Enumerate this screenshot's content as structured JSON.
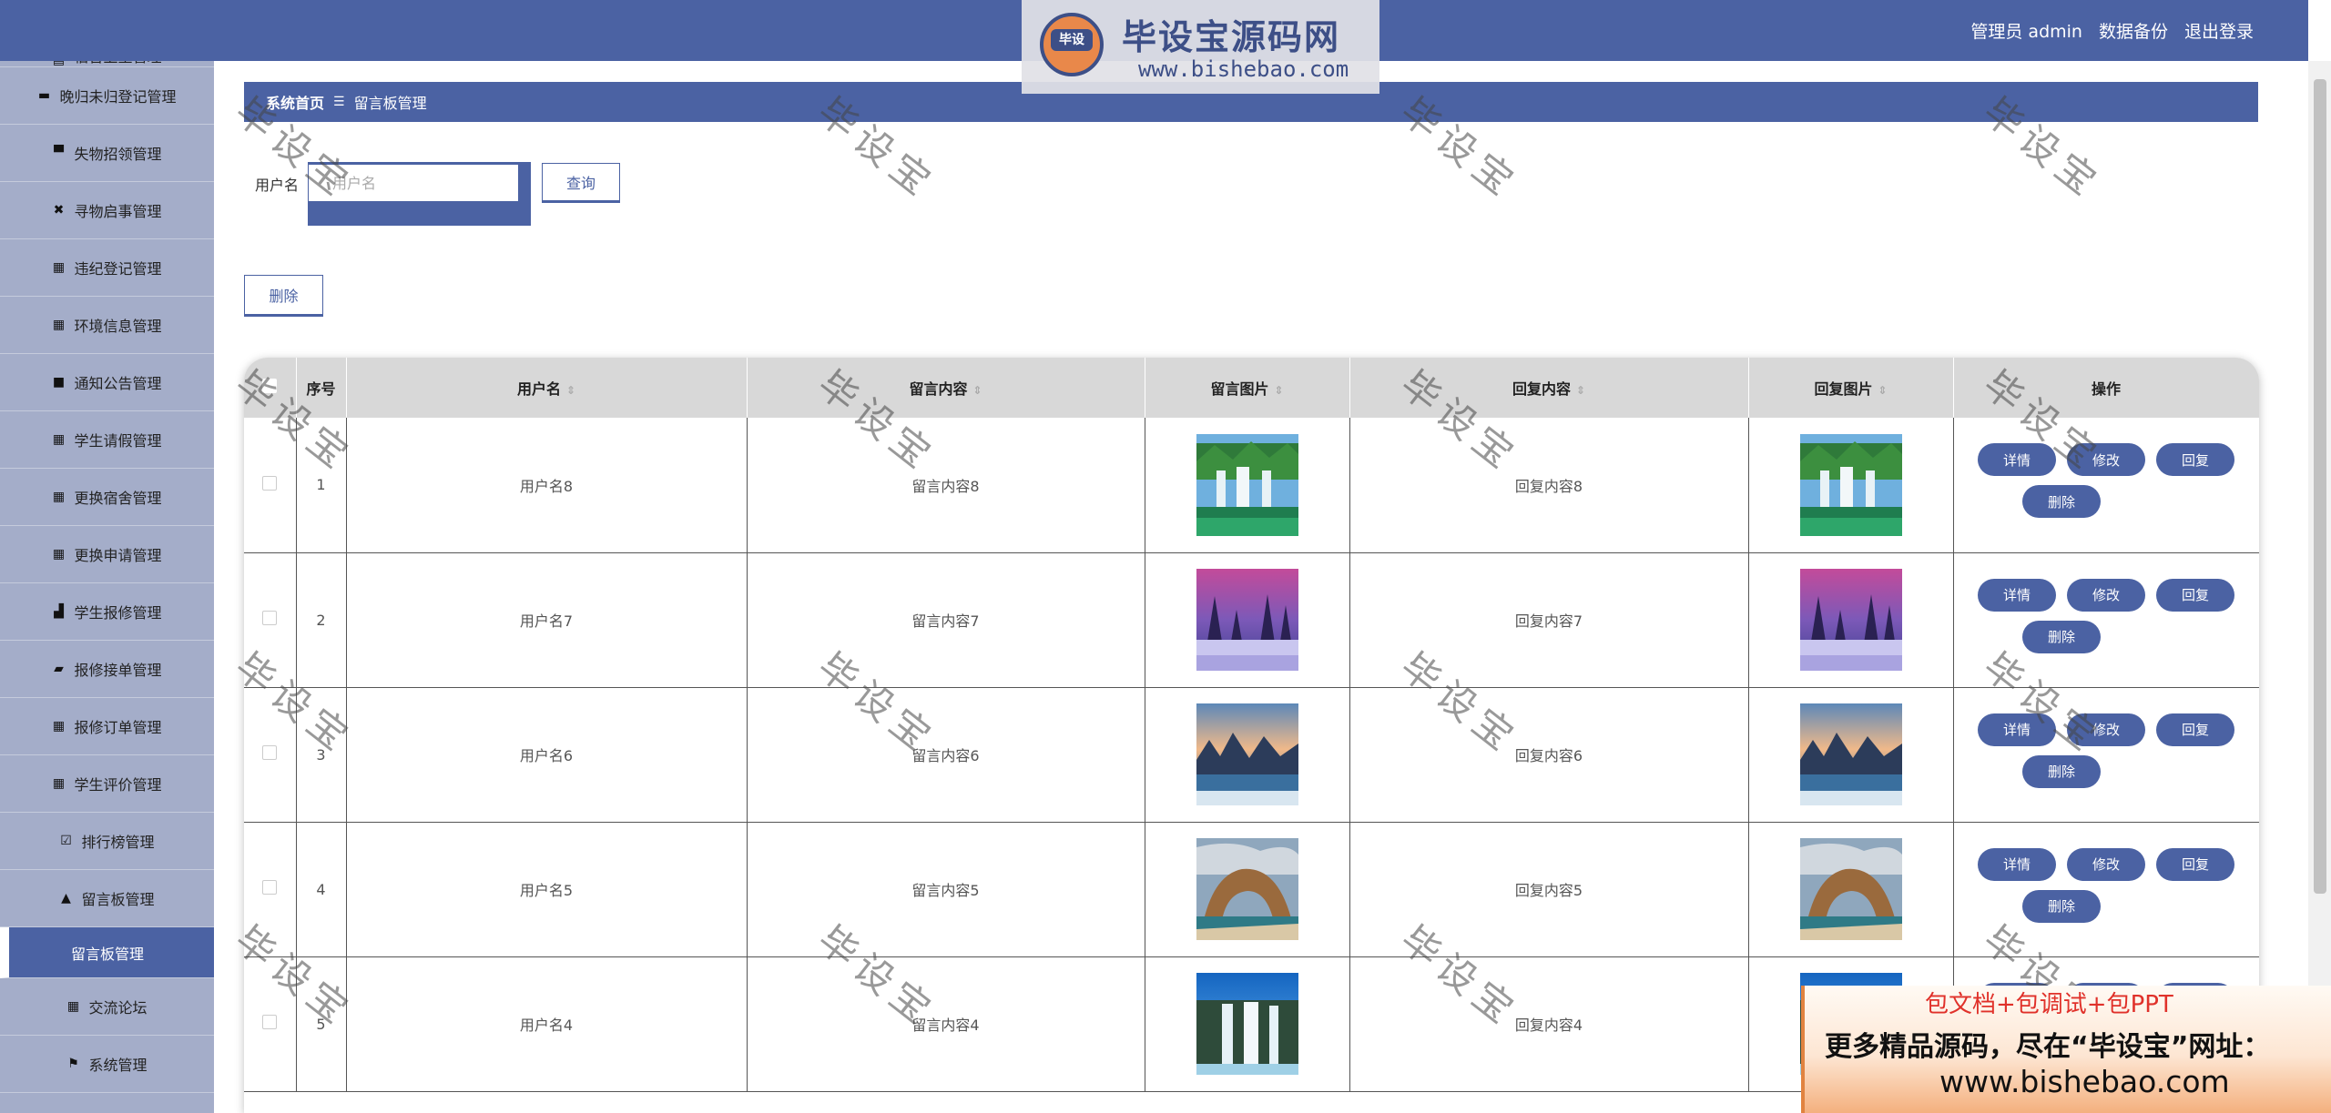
{
  "header": {
    "admin_label": "管理员 admin",
    "backup_label": "数据备份",
    "logout_label": "退出登录"
  },
  "logo": {
    "badge": "毕设",
    "title": "毕设宝源码网",
    "url": "www.bishebao.com"
  },
  "sidebar": {
    "items": [
      {
        "label": "宿舍卫生管理",
        "icon": "doc-icon",
        "glyph": "▤"
      },
      {
        "label": "晚归未归登记管理",
        "icon": "comment-icon",
        "glyph": "▬"
      },
      {
        "label": "失物招领管理",
        "icon": "printer-icon",
        "glyph": "▀"
      },
      {
        "label": "寻物启事管理",
        "icon": "clipboard-x-icon",
        "glyph": "✖"
      },
      {
        "label": "违纪登记管理",
        "icon": "grid-icon",
        "glyph": "▦"
      },
      {
        "label": "环境信息管理",
        "icon": "grid-icon",
        "glyph": "▦"
      },
      {
        "label": "通知公告管理",
        "icon": "monitor-icon",
        "glyph": "■"
      },
      {
        "label": "学生请假管理",
        "icon": "grid-icon",
        "glyph": "▦"
      },
      {
        "label": "更换宿舍管理",
        "icon": "grid-icon",
        "glyph": "▦"
      },
      {
        "label": "更换申请管理",
        "icon": "grid-icon",
        "glyph": "▦"
      },
      {
        "label": "学生报修管理",
        "icon": "thumb-icon",
        "glyph": "▟"
      },
      {
        "label": "报修接单管理",
        "icon": "ticket-icon",
        "glyph": "▰"
      },
      {
        "label": "报修订单管理",
        "icon": "grid-icon",
        "glyph": "▦"
      },
      {
        "label": "学生评价管理",
        "icon": "grid-icon",
        "glyph": "▦"
      },
      {
        "label": "排行榜管理",
        "icon": "check-square-icon",
        "glyph": "☑"
      },
      {
        "label": "留言板管理",
        "icon": "user-icon",
        "glyph": "▲"
      }
    ],
    "active_sub": "留言板管理",
    "after": [
      {
        "label": "交流论坛",
        "icon": "grid-icon",
        "glyph": "▦"
      },
      {
        "label": "系统管理",
        "icon": "flag-icon",
        "glyph": "⚑"
      }
    ]
  },
  "breadcrumb": {
    "home": "系统首页",
    "sep": "☰",
    "current": "留言板管理"
  },
  "search": {
    "label": "用户名",
    "placeholder": "用户名",
    "button": "查询"
  },
  "actions": {
    "delete": "删除"
  },
  "table": {
    "headers": [
      "序号",
      "用户名",
      "留言内容",
      "留言图片",
      "回复内容",
      "回复图片",
      "操作"
    ],
    "sort_glyph": "⇕",
    "rows": [
      {
        "index": "1",
        "user": "用户名8",
        "content": "留言内容8",
        "reply": "回复内容8",
        "img": "waterfall"
      },
      {
        "index": "2",
        "user": "用户名7",
        "content": "留言内容7",
        "reply": "回复内容7",
        "img": "snow"
      },
      {
        "index": "3",
        "user": "用户名6",
        "content": "留言内容6",
        "reply": "回复内容6",
        "img": "mountain"
      },
      {
        "index": "4",
        "user": "用户名5",
        "content": "留言内容5",
        "reply": "回复内容5",
        "img": "arch"
      },
      {
        "index": "5",
        "user": "用户名4",
        "content": "留言内容4",
        "reply": "回复内容4",
        "img": "falls"
      }
    ],
    "buttons": {
      "detail": "详情",
      "edit": "修改",
      "reply": "回复",
      "delete": "删除"
    }
  },
  "watermark_text": "毕设宝",
  "promo": {
    "line1": "包文档+包调试+包PPT",
    "line2": "更多精品源码，尽在“毕设宝”网址：",
    "line3": "www.bishebao.com"
  }
}
